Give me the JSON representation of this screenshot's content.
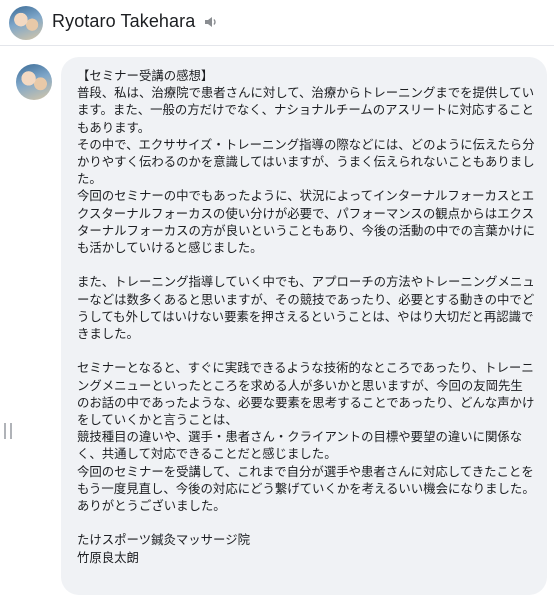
{
  "header": {
    "name": "Ryotaro Takehara",
    "avatar_icon": "profile-photo",
    "speaker_icon": "speaker-icon"
  },
  "message": {
    "text": "【セミナー受講の感想】\n普段、私は、治療院で患者さんに対して、治療からトレーニングまでを提供しています。また、一般の方だけでなく、ナショナルチームのアスリートに対応することもあります。\nその中で、エクササイズ・トレーニング指導の際などには、どのように伝えたら分かりやすく伝わるのかを意識してはいますが、うまく伝えられないこともありました。\n今回のセミナーの中でもあったように、状況によってインターナルフォーカスとエクスターナルフォーカスの使い分けが必要で、パフォーマンスの観点からはエクスターナルフォーカスの方が良いということもあり、今後の活動の中での言葉かけにも活かしていけると感じました。\n\nまた、トレーニング指導していく中でも、アプローチの方法やトレーニングメニューなどは数多くあると思いますが、その競技であったり、必要とする動きの中でどうしても外してはいけない要素を押さえるということは、やはり大切だと再認識できました。\n\nセミナーとなると、すぐに実践できるような技術的なところであったり、トレーニングメニューといったところを求める人が多いかと思いますが、今回の友岡先生のお話の中であったような、必要な要素を思考することであったり、どんな声かけをしていくかと言うことは、\n競技種目の違いや、選手・患者さん・クライアントの目標や要望の違いに関係なく、共通して対応できることだと感じました。\n今回のセミナーを受講して、これまで自分が選手や患者さんに対応してきたことをもう一度見直し、今後の対応にどう繋げていくかを考えるいい機会になりました。\nありがとうございました。\n\nたけスポーツ鍼灸マッサージ院\n竹原良太朗"
  }
}
